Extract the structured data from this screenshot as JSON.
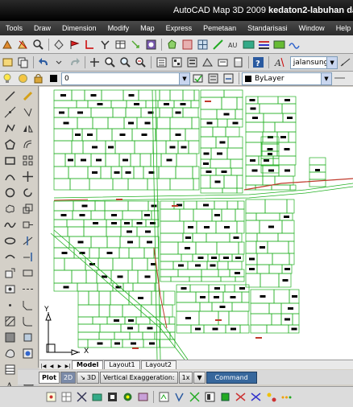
{
  "window": {
    "app_title": "AutoCAD Map 3D 2009",
    "drawing_title": "kedaton2-labuhan dalam"
  },
  "menu": [
    "Tools",
    "Draw",
    "Dimension",
    "Modify",
    "Map",
    "Express",
    "Pemetaan",
    "Standarisasi",
    "Window",
    "Help"
  ],
  "toolbar2": {
    "text_style_value": "jalansungai"
  },
  "layer_bar": {
    "layer_value": "0",
    "color_value": "ByLayer"
  },
  "ucs": {
    "x_label": "X",
    "y_label": "Y"
  },
  "layout_tabs": [
    "Model",
    "Layout1",
    "Layout2"
  ],
  "statusbar": {
    "plot_label": "Plot",
    "mode_2d": "2D",
    "mode_3d": "3D",
    "vertical_exaggeration_label": "Vertical Exaggeration:",
    "vertical_exaggeration_value": "1x",
    "command_label": "Command"
  },
  "colors": {
    "parcel_lines": "#22b022",
    "road_lines": "#c0392b",
    "buildings": "#000000",
    "title_bar": "#111111"
  }
}
